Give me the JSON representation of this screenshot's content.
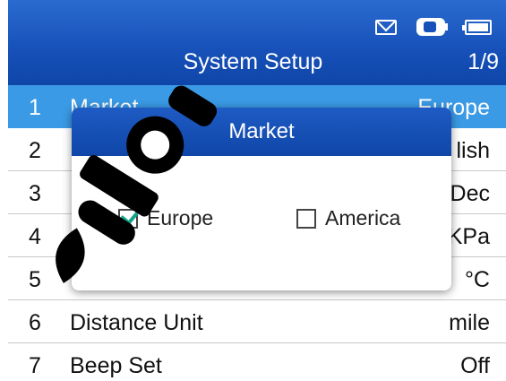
{
  "header": {
    "title": "System Setup",
    "page": "1/9"
  },
  "status_icons": [
    "mail-icon",
    "vci-icon",
    "battery-icon"
  ],
  "menu": {
    "items": [
      {
        "num": "1",
        "label": "Market",
        "value": "Europe"
      },
      {
        "num": "2",
        "label": "",
        "value": "lish"
      },
      {
        "num": "3",
        "label": "",
        "value": "Dec"
      },
      {
        "num": "4",
        "label": "",
        "value": "KPa"
      },
      {
        "num": "5",
        "label": "",
        "value": "°C"
      },
      {
        "num": "6",
        "label": "Distance Unit",
        "value": "mile"
      },
      {
        "num": "7",
        "label": "Beep Set",
        "value": "Off"
      }
    ]
  },
  "dialog": {
    "title": "Market",
    "options": [
      {
        "label": "Europe",
        "checked": true
      },
      {
        "label": "America",
        "checked": false
      }
    ]
  },
  "colors": {
    "header": "#1650b8",
    "selected_row": "#3a9ae5",
    "checkmark": "#14a38a"
  }
}
